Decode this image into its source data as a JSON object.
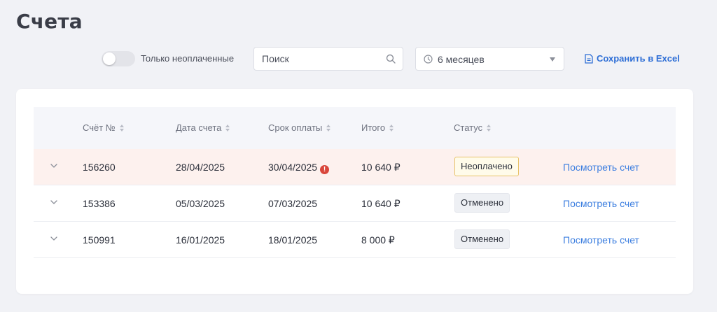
{
  "page": {
    "title": "Счета"
  },
  "filters": {
    "unpaid_only_label": "Только неоплаченные",
    "unpaid_only_on": false,
    "search_placeholder": "Поиск",
    "period_value": "6 месяцев",
    "export_label": "Сохранить в Excel"
  },
  "table": {
    "columns": [
      "Счёт №",
      "Дата счета",
      "Срок оплаты",
      "Итого",
      "Статус"
    ],
    "rows": [
      {
        "number": "156260",
        "date": "28/04/2025",
        "due": "30/04/2025",
        "overdue": true,
        "total": "10 640 ₽",
        "status": "Неоплачено",
        "status_type": "unpaid",
        "action": "Посмотреть счет"
      },
      {
        "number": "153386",
        "date": "05/03/2025",
        "due": "07/03/2025",
        "overdue": false,
        "total": "10 640 ₽",
        "status": "Отменено",
        "status_type": "cancelled",
        "action": "Посмотреть счет"
      },
      {
        "number": "150991",
        "date": "16/01/2025",
        "due": "18/01/2025",
        "overdue": false,
        "total": "8 000 ₽",
        "status": "Отменено",
        "status_type": "cancelled",
        "action": "Посмотреть счет"
      }
    ]
  },
  "colors": {
    "accent": "#3d7fe0",
    "unpaid_row_bg": "#fdf1ee",
    "overdue": "#d9463b",
    "unpaid_badge_border": "#e8c36a"
  },
  "icons": {
    "search": "search-icon",
    "period": "clock-icon",
    "export": "document-icon",
    "expand": "chevron-down-icon",
    "overdue": "alert-icon",
    "sort": "sort-icon"
  }
}
